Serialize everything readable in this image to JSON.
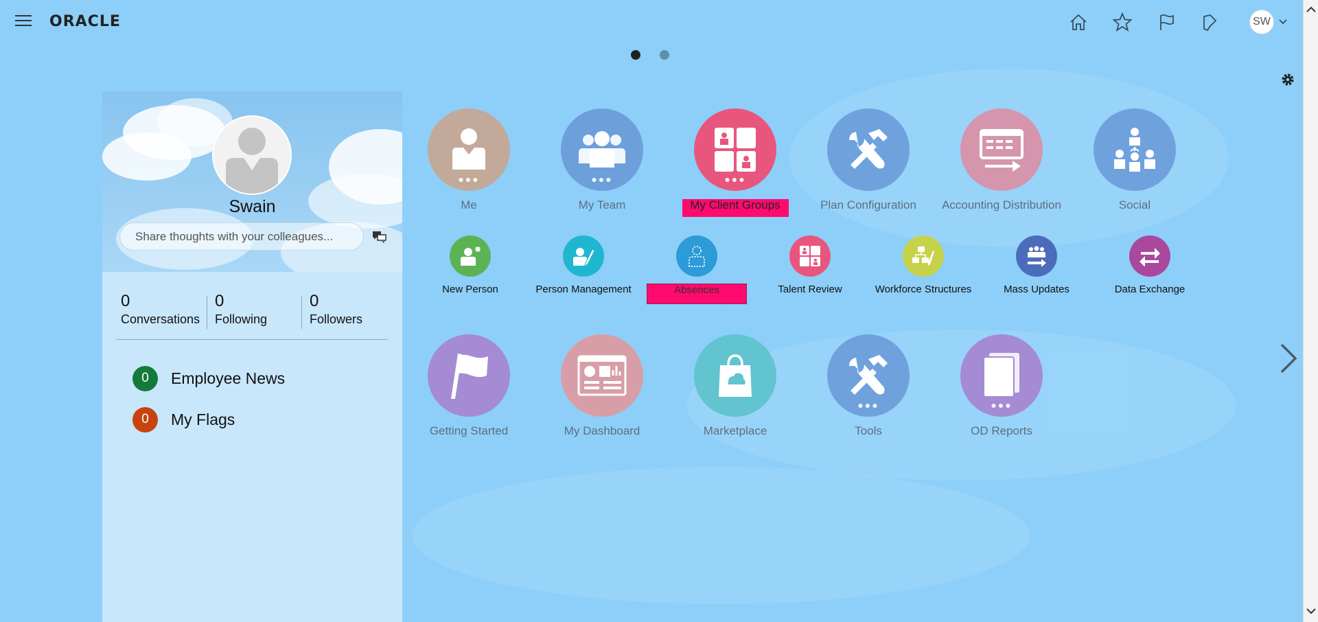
{
  "header": {
    "logo": "ORACLE",
    "avatar_initials": "SW",
    "icons": [
      "menu-icon",
      "home-icon",
      "star-icon",
      "flag-icon",
      "bell-icon",
      "chevron-down-icon"
    ]
  },
  "pager": {
    "page_count": 2,
    "active_page": 1
  },
  "profile": {
    "name": "Swain",
    "share_placeholder": "Share thoughts with your colleagues...",
    "stats": [
      {
        "count": "0",
        "label": "Conversations"
      },
      {
        "count": "0",
        "label": "Following"
      },
      {
        "count": "0",
        "label": "Followers"
      }
    ],
    "news": [
      {
        "count": "0",
        "label": "Employee News",
        "color": "#137a3c"
      },
      {
        "count": "0",
        "label": "My Flags",
        "color": "#c8440f"
      }
    ]
  },
  "apps_row1": [
    {
      "label": "Me",
      "color": "#c2a99a",
      "icon": "person-icon"
    },
    {
      "label": "My Team",
      "color": "#6d9fdb",
      "icon": "team-icon"
    },
    {
      "label": "My Client Groups",
      "color": "#e8567e",
      "icon": "client-groups-icon"
    },
    {
      "label": "Plan Configuration",
      "color": "#6fa2dd",
      "icon": "tools-icon"
    },
    {
      "label": "Accounting Distribution",
      "color": "#d595ad",
      "icon": "ledger-icon"
    },
    {
      "label": "Social",
      "color": "#6fa2dd",
      "icon": "org-icon"
    }
  ],
  "apps_row2": [
    {
      "label": "New Person",
      "color": "#5bb354",
      "icon": "new-person-icon"
    },
    {
      "label": "Person Management",
      "color": "#1fb6d0",
      "icon": "person-edit-icon"
    },
    {
      "label": "Absences",
      "color": "#2d9bd8",
      "icon": "absence-icon"
    },
    {
      "label": "Talent Review",
      "color": "#e8567e",
      "icon": "talent-review-icon"
    },
    {
      "label": "Workforce Structures",
      "color": "#c5d34a",
      "icon": "structure-icon"
    },
    {
      "label": "Mass Updates",
      "color": "#4b6cba",
      "icon": "mass-update-icon"
    },
    {
      "label": "Data Exchange",
      "color": "#a9489c",
      "icon": "exchange-icon"
    }
  ],
  "apps_row3": [
    {
      "label": "Getting Started",
      "color": "#a48bd3",
      "icon": "flag-icon"
    },
    {
      "label": "My Dashboard",
      "color": "#d89ea7",
      "icon": "dashboard-icon"
    },
    {
      "label": "Marketplace",
      "color": "#61c4cf",
      "icon": "bag-icon"
    },
    {
      "label": "Tools",
      "color": "#6fa2dd",
      "icon": "tools-icon"
    },
    {
      "label": "OD Reports",
      "color": "#a48bd3",
      "icon": "reports-icon"
    }
  ]
}
